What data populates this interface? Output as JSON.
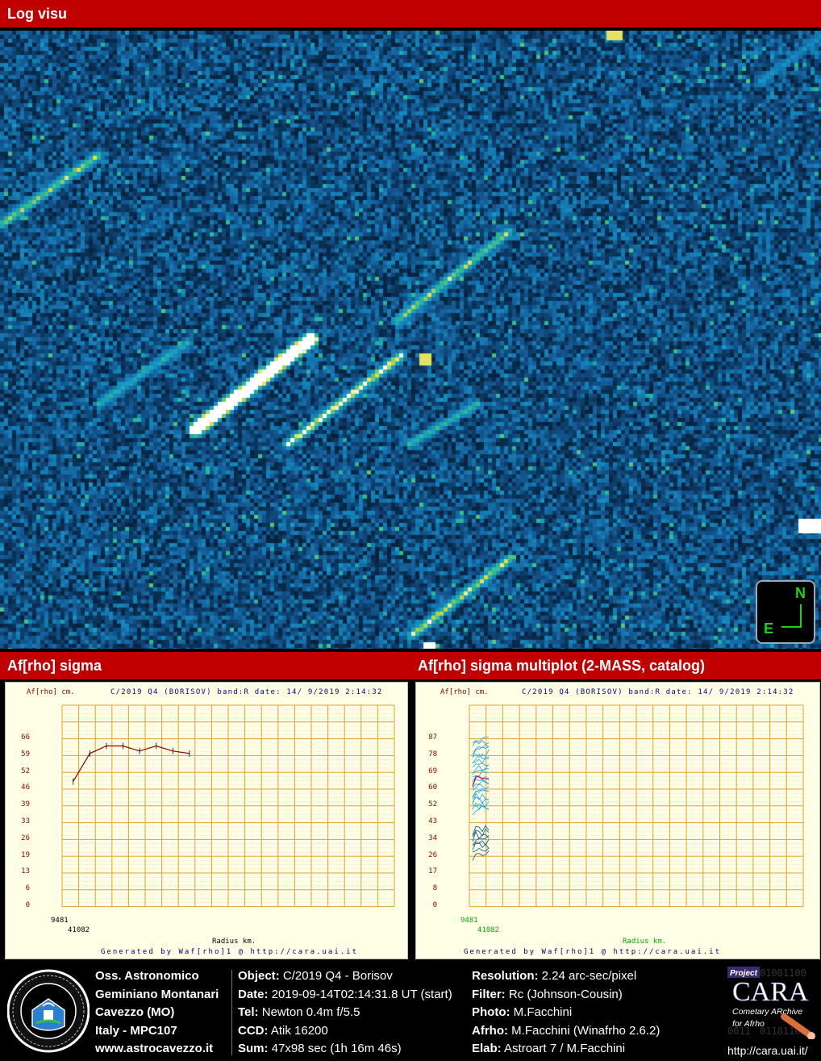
{
  "header": {
    "title": "Log visu"
  },
  "compass": {
    "north": "N",
    "east": "E"
  },
  "section": {
    "left_title": "Af[rho] sigma",
    "right_title": "Af[rho] sigma multiplot (2-MASS, catalog)"
  },
  "left_plot": {
    "unit": "Af[rho] cm.",
    "title": "C/2019 Q4 (BORISOV) band:R date: 14/ 9/2019  2:14:32",
    "xlabel": "Radius km.",
    "generated": "Generated by Waf[rho]1 @ http://cara.uai.it",
    "yticks": [
      "66",
      "59",
      "52",
      "46",
      "39",
      "33",
      "26",
      "19",
      "13",
      "6",
      "0"
    ],
    "xticks": [
      "9481",
      "41082"
    ]
  },
  "right_plot": {
    "unit": "Af[rho] cm.",
    "title": "C/2019 Q4 (BORISOV) band:R date: 14/ 9/2019  2:14:32",
    "xlabel": "Radius km.",
    "generated": "Generated by Waf[rho]1 @ http://cara.uai.it",
    "yticks": [
      "87",
      "78",
      "69",
      "60",
      "52",
      "43",
      "34",
      "26",
      "17",
      "8",
      "0"
    ],
    "xticks": [
      "9481",
      "41082"
    ]
  },
  "chart_data": [
    {
      "type": "line",
      "title": "C/2019 Q4 (BORISOV) band:R date: 14/ 9/2019  2:14:32",
      "xlabel": "Radius km.",
      "ylabel": "Af[rho] cm.",
      "ylim": [
        0,
        66
      ],
      "series": [
        {
          "x": [
            1000,
            2500,
            4000,
            5500,
            7000,
            8500,
            10000,
            11500
          ],
          "values": [
            49,
            60,
            63,
            63,
            61,
            63,
            61,
            60
          ]
        }
      ]
    },
    {
      "type": "line",
      "title": "C/2019 Q4 (BORISOV) band:R date: 14/ 9/2019  2:14:32",
      "xlabel": "Radius km.",
      "ylabel": "Af[rho] cm.",
      "ylim": [
        0,
        87
      ],
      "series_count_estimate": 30,
      "series_range_values": [
        28,
        86
      ],
      "highlight_values": [
        62,
        67,
        67,
        66,
        66,
        66
      ]
    }
  ],
  "footer": {
    "observatory": [
      "Oss. Astronomico",
      "Geminiano Montanari",
      "Cavezzo (MO)",
      "Italy - MPC107",
      "www.astrocavezzo.it"
    ],
    "col1": [
      {
        "label": "Object:",
        "value": "C/2019 Q4 - Borisov"
      },
      {
        "label": "Date:",
        "value": "2019-09-14T02:14:31.8 UT (start)"
      },
      {
        "label": "Tel:",
        "value": "Newton 0.4m f/5.5"
      },
      {
        "label": "CCD:",
        "value": "Atik 16200"
      },
      {
        "label": "Sum:",
        "value": "47x98 sec (1h 16m 46s)"
      }
    ],
    "col2": [
      {
        "label": "Resolution:",
        "value": "2.24 arc-sec/pixel"
      },
      {
        "label": "Filter:",
        "value": "Rc (Johnson-Cousin)"
      },
      {
        "label": "Photo:",
        "value": "M.Facchini"
      },
      {
        "label": "Afrho:",
        "value": "M.Facchini (Winafrho 2.6.2)"
      },
      {
        "label": "Elab:",
        "value": "Astroart 7 / M.Facchini"
      }
    ],
    "cara": {
      "project": "Project",
      "name": "CARA",
      "subtitle": "Cometary ARchive",
      "sub2": "for Afrho",
      "url": "http://cara.uai.it/"
    }
  }
}
